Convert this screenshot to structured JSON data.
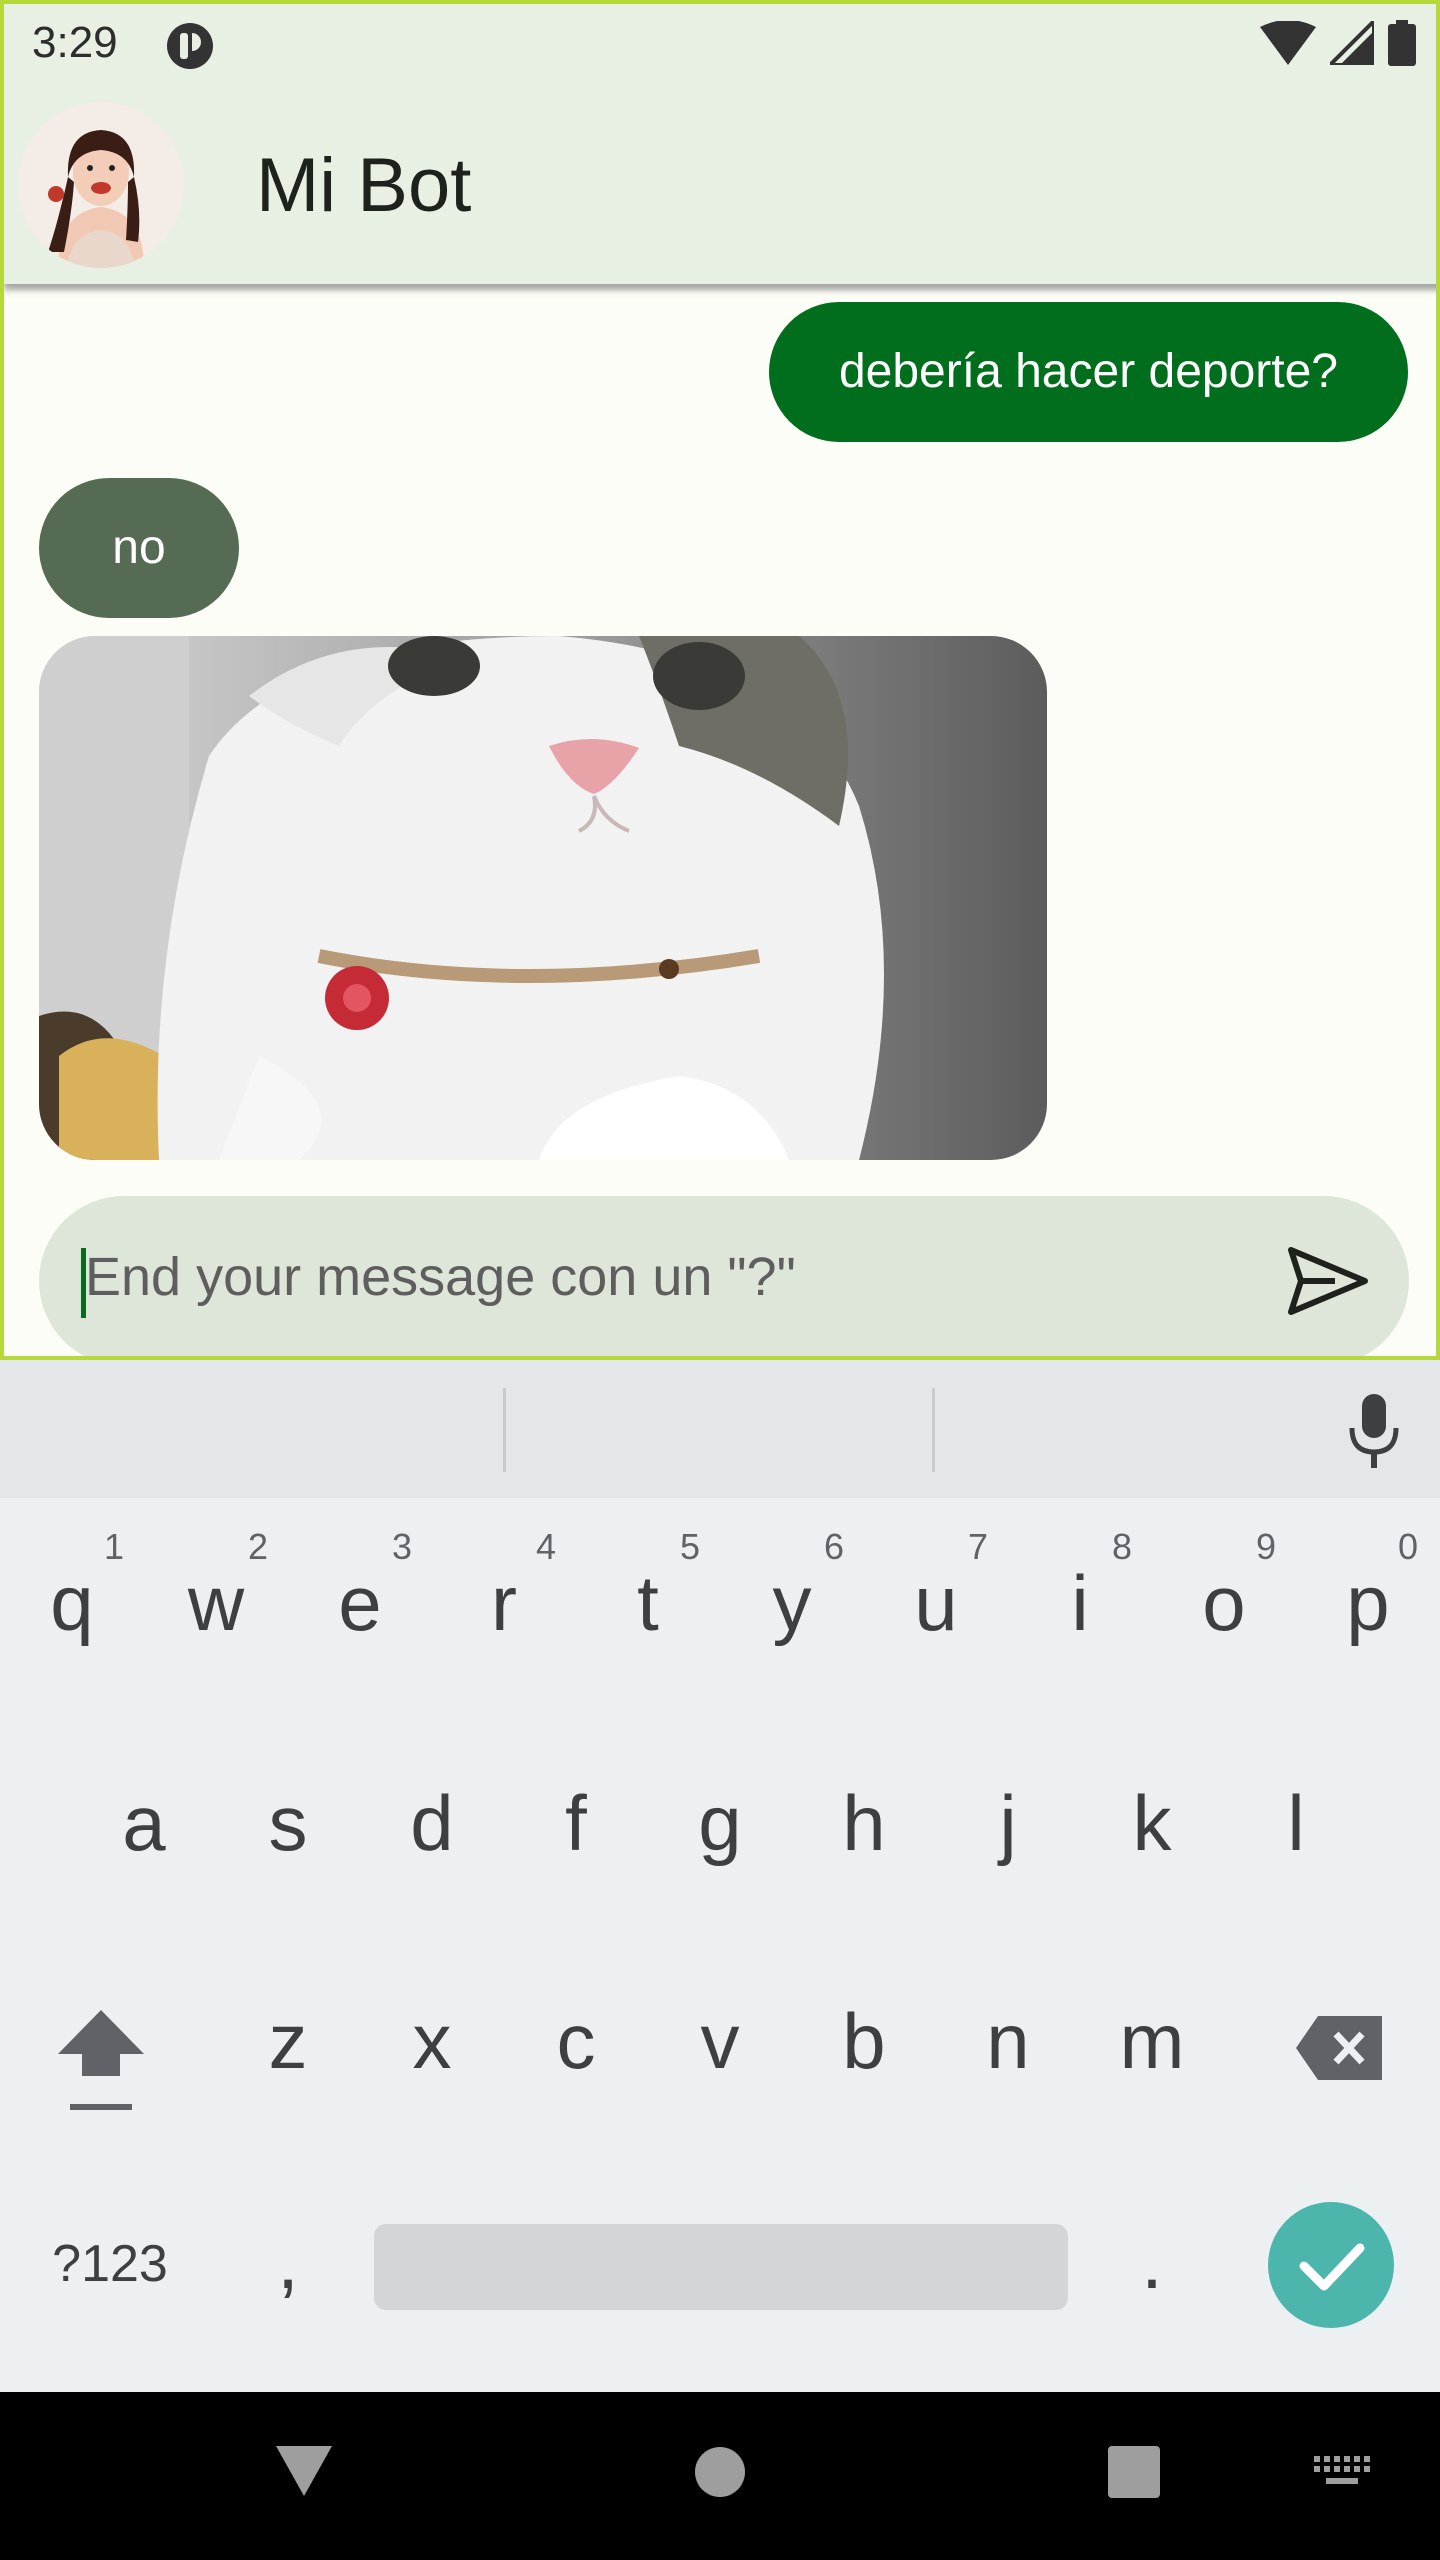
{
  "status_bar": {
    "time": "3:29"
  },
  "app_bar": {
    "title": "Mi Bot"
  },
  "messages": [
    {
      "from": "user",
      "text": "debería hacer deporte?"
    },
    {
      "from": "bot",
      "text": "no"
    },
    {
      "from": "bot",
      "image": "cat-gif"
    }
  ],
  "composer": {
    "placeholder": "End your message con un \"?\""
  },
  "keyboard": {
    "row1": [
      "q",
      "w",
      "e",
      "r",
      "t",
      "y",
      "u",
      "i",
      "o",
      "p"
    ],
    "row1_hints": [
      "1",
      "2",
      "3",
      "4",
      "5",
      "6",
      "7",
      "8",
      "9",
      "0"
    ],
    "row2": [
      "a",
      "s",
      "d",
      "f",
      "g",
      "h",
      "j",
      "k",
      "l"
    ],
    "row3": [
      "z",
      "x",
      "c",
      "v",
      "b",
      "n",
      "m"
    ],
    "symbols_label": "?123",
    "comma": ",",
    "period": "."
  },
  "colors": {
    "app_bar_bg": "#e8f0e4",
    "user_bubble": "#006e1c",
    "bot_bubble": "#556b54",
    "enter_button": "#4db6ac"
  }
}
